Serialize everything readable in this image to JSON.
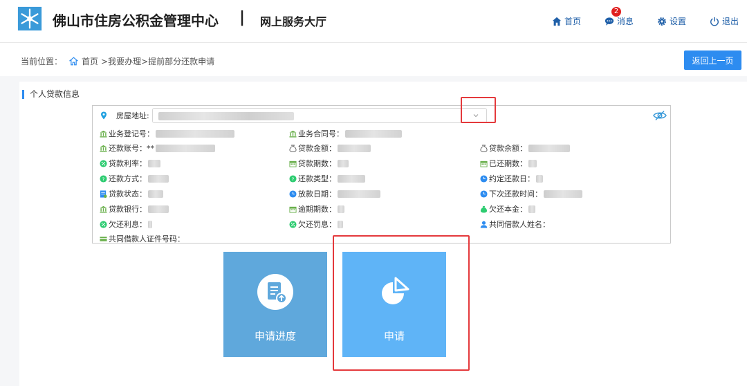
{
  "header": {
    "org_title": "佛山市住房公积金管理中心",
    "separator": "|",
    "hall_title": "网上服务大厅",
    "nav": {
      "home": "首页",
      "messages": "消息",
      "messages_badge": "2",
      "settings": "设置",
      "logout": "退出"
    }
  },
  "breadcrumb": {
    "prefix": "当前位置：",
    "home": "首页",
    "path": ">我要办理>提前部分还款申请"
  },
  "back_button": "返回上一页",
  "section_title": "个人贷款信息",
  "address": {
    "label": "房屋地址:"
  },
  "fields": {
    "business_reg_no": "业务登记号：",
    "business_contract_no": "业务合同号：",
    "repay_account": "还款账号：",
    "repay_account_masked": "**",
    "loan_amount": "贷款金额：",
    "loan_balance": "贷款余额：",
    "loan_rate": "贷款利率：",
    "loan_term": "贷款期数：",
    "paid_terms": "已还期数：",
    "repay_method": "还款方式：",
    "repay_type": "还款类型：",
    "agreed_repay_day": "约定还款日：",
    "loan_status": "贷款状态：",
    "disburse_date": "放款日期：",
    "next_repay_time": "下次还款时间：",
    "loan_bank": "贷款银行：",
    "overdue_terms": "逾期期数：",
    "owed_principal": "欠还本金：",
    "owed_interest": "欠还利息：",
    "owed_penalty": "欠还罚息：",
    "co_borrower_name": "共同借款人姓名：",
    "co_borrower_id": "共同借款人证件号码："
  },
  "tiles": {
    "progress": "申请进度",
    "apply": "申请"
  },
  "colors": {
    "primary": "#2d8cf0",
    "tile_progress": "#5fa8dc",
    "tile_apply": "#5fb4f7",
    "highlight": "#e4393c",
    "nav_text": "#1f5fa8"
  }
}
